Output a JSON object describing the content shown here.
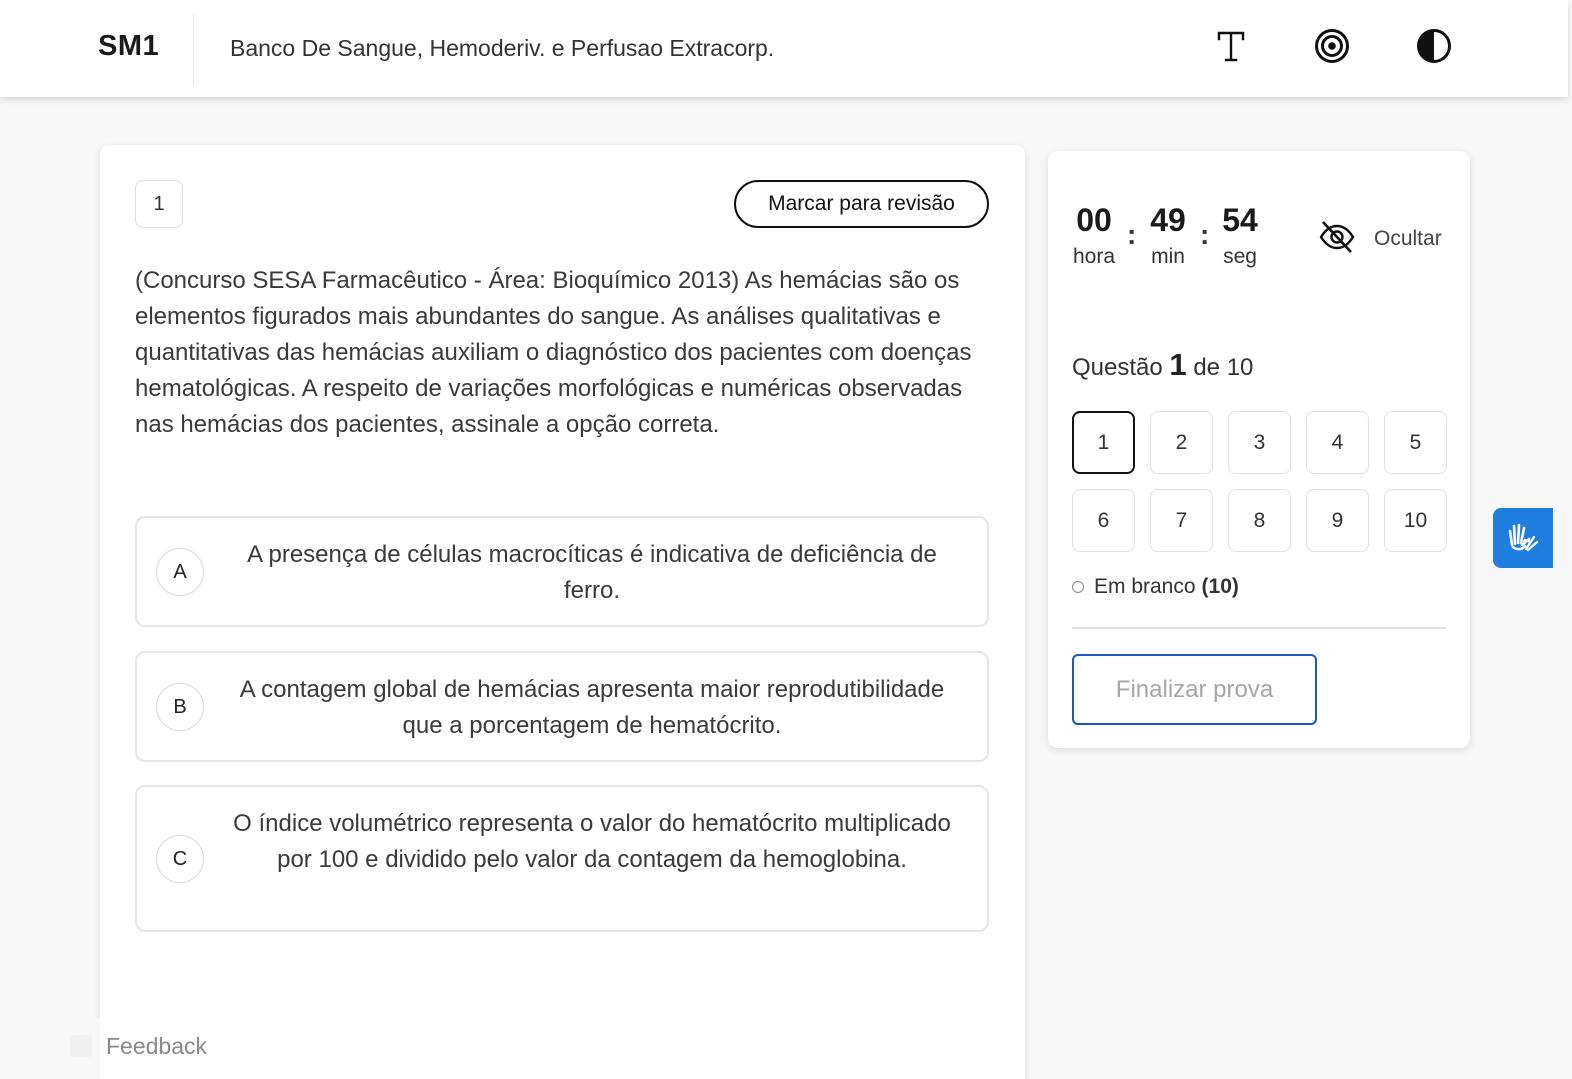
{
  "header": {
    "logo": "SM1",
    "course_title": "Banco De Sangue, Hemoderiv. e Perfusao Extracorp.",
    "icons": [
      "font-size-icon",
      "target-icon",
      "contrast-icon"
    ]
  },
  "question": {
    "number": "1",
    "review_label": "Marcar para revisão",
    "text": "(Concurso SESA Farmacêutico - Área: Bioquímico 2013) As hemácias são os elementos figurados mais abundantes do sangue. As análises qualitativas e quantitativas das hemácias auxiliam o diagnóstico dos pacientes com doenças hematológicas. A respeito de variações morfológicas e numéricas observadas nas hemácias dos pacientes, assinale a opção correta.",
    "options": [
      {
        "letter": "A",
        "text": "A presença de células macrocíticas é indicativa de deficiência de ferro."
      },
      {
        "letter": "B",
        "text": "A contagem global de hemácias apresenta maior reprodutibilidade que a porcentagem de hematócrito."
      },
      {
        "letter": "C",
        "text": "O índice volumétrico representa o valor do hematócrito multiplicado por 100 e dividido pelo valor da contagem da hemoglobina."
      }
    ]
  },
  "timer": {
    "hours": "00",
    "hours_label": "hora",
    "minutes": "49",
    "minutes_label": "min",
    "seconds": "54",
    "seconds_label": "seg",
    "separator": ":",
    "hide_label": "Ocultar"
  },
  "navigator": {
    "prefix": "Questão",
    "current": "1",
    "suffix": "de 10",
    "questions": [
      "1",
      "2",
      "3",
      "4",
      "5",
      "6",
      "7",
      "8",
      "9",
      "10"
    ],
    "legend_label": "Em branco",
    "legend_count": "(10)",
    "finish_label": "Finalizar prova"
  },
  "feedback": {
    "label": "Feedback"
  },
  "colors": {
    "accent": "#1a56c4",
    "vlibras": "#1e7fe0"
  }
}
